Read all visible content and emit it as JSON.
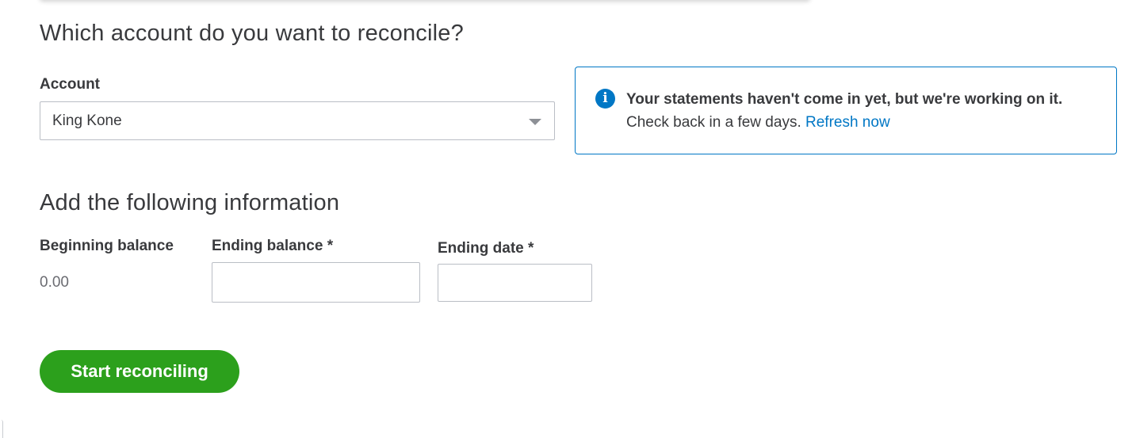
{
  "reconcile_section": {
    "heading": "Which account do you want to reconcile?",
    "account_label": "Account",
    "account_value": "King Kone"
  },
  "info_banner": {
    "title": "Your statements haven't come in yet, but we're working on it.",
    "body": "Check back in a few days.",
    "link": "Refresh now",
    "icon": "info-icon",
    "accent_color": "#0077c5"
  },
  "info_section": {
    "heading": "Add the following information",
    "beginning_balance_label": "Beginning balance",
    "beginning_balance_value": "0.00",
    "ending_balance_label": "Ending balance *",
    "ending_balance_value": "",
    "ending_date_label": "Ending date *",
    "ending_date_value": ""
  },
  "actions": {
    "start_label": "Start reconciling",
    "start_color": "#2ca01c"
  }
}
